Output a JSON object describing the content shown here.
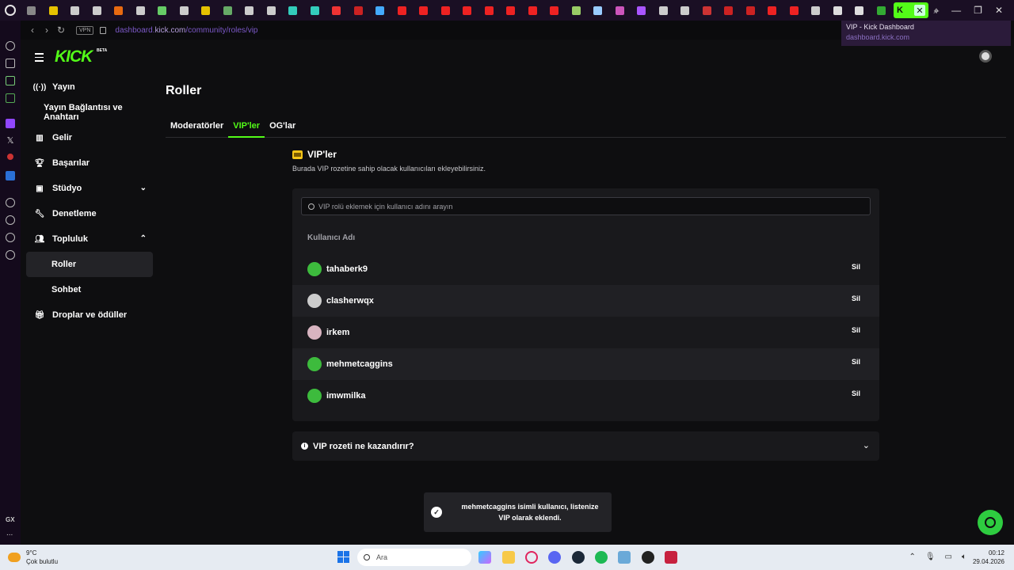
{
  "browser": {
    "url_prefix": "dashboard.",
    "url_domain": "kick.com",
    "url_path": "/community/roles/vip",
    "vpn_label": "VPN",
    "tooltip_title": "VIP - Kick Dashboard",
    "tooltip_url": "dashboard.kick.com"
  },
  "brand": {
    "logo": "KICK",
    "beta": "BETA",
    "accent": "#53fc18"
  },
  "sidebar": {
    "items": [
      {
        "label": "Yayın",
        "icon": "broadcast-icon"
      },
      {
        "label": "Yayın Bağlantısı ve Anahtarı",
        "icon": ""
      },
      {
        "label": "Gelir",
        "icon": "chart-icon"
      },
      {
        "label": "Başarılar",
        "icon": "trophy-icon"
      },
      {
        "label": "Stüdyo",
        "icon": "studio-icon"
      },
      {
        "label": "Denetleme",
        "icon": "wrench-icon"
      },
      {
        "label": "Topluluk",
        "icon": "community-icon"
      },
      {
        "label": "Roller",
        "icon": ""
      },
      {
        "label": "Sohbet",
        "icon": ""
      },
      {
        "label": "Droplar ve ödüller",
        "icon": "gift-icon"
      }
    ]
  },
  "main": {
    "title": "Roller",
    "tabs": [
      "Moderatörler",
      "VIP'ler",
      "OG'lar"
    ],
    "active_tab": "VIP'ler",
    "section_title": "VIP'ler",
    "section_desc": "Burada VIP rozetine sahip olacak kullanıcıları ekleyebilirsiniz.",
    "search_placeholder": "VIP rolü eklemek için kullanıcı adını arayın",
    "column_header": "Kullanıcı Adı",
    "remove_label": "Sil",
    "users": [
      "tahaberk9",
      "clasherwqx",
      "irkem",
      "mehmetcaggins",
      "imwmilka"
    ],
    "faq_title": "VIP rozeti ne kazandırır?"
  },
  "toast": {
    "message": "mehmetcaggins isimli kullanıcı, listenize VIP olarak eklendi."
  },
  "taskbar": {
    "temp": "9°C",
    "weather": "Çok bulutlu",
    "search_label": "Ara",
    "time": "00:12",
    "date": "29.04.2026"
  },
  "rail": {
    "gx_label": "GX",
    "more": "..."
  }
}
